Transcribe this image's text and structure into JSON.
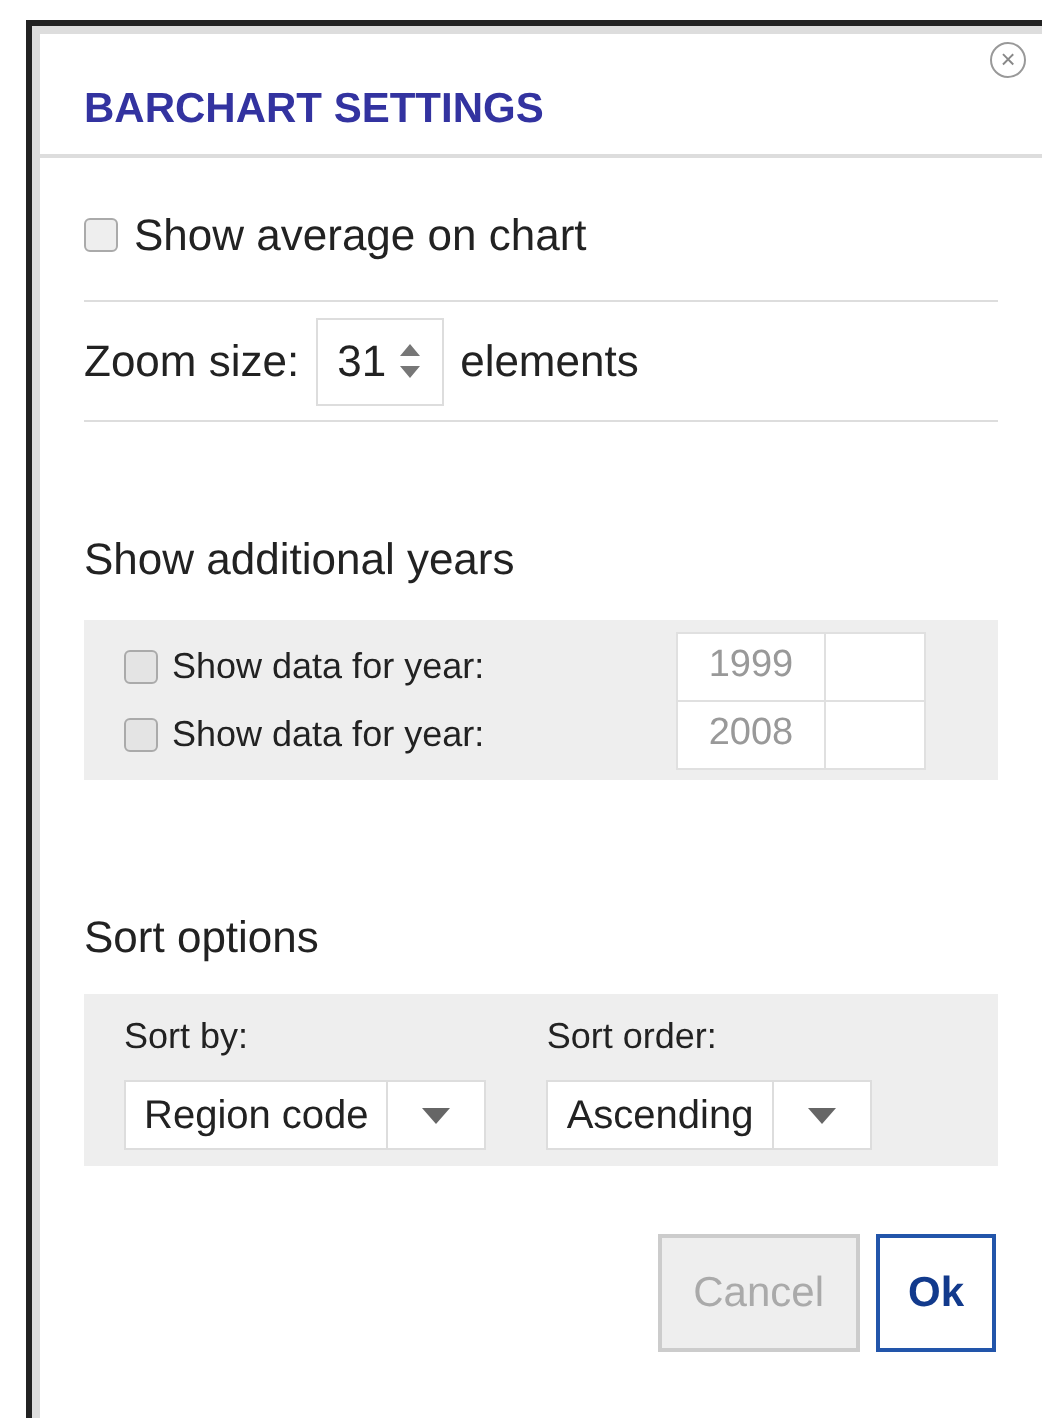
{
  "dialog": {
    "title": "BARCHART SETTINGS",
    "close": "×"
  },
  "show_average": {
    "label": "Show average on chart",
    "checked": false
  },
  "zoom": {
    "label": "Zoom size:",
    "value": "31",
    "unit": "elements"
  },
  "additional_years": {
    "heading": "Show additional years",
    "rows": [
      {
        "label": "Show data for year:",
        "checked": false,
        "value": "1999",
        "disabled": true
      },
      {
        "label": "Show data for year:",
        "checked": false,
        "value": "2008",
        "disabled": true
      }
    ]
  },
  "sort": {
    "heading": "Sort options",
    "fields": [
      {
        "label": "Sort by:",
        "value": "Region code"
      },
      {
        "label": "Sort order:",
        "value": "Ascending"
      }
    ]
  },
  "buttons": [
    {
      "label": "Cancel",
      "disabled": true,
      "primary": false
    },
    {
      "label": "Ok",
      "disabled": false,
      "primary": true
    }
  ]
}
